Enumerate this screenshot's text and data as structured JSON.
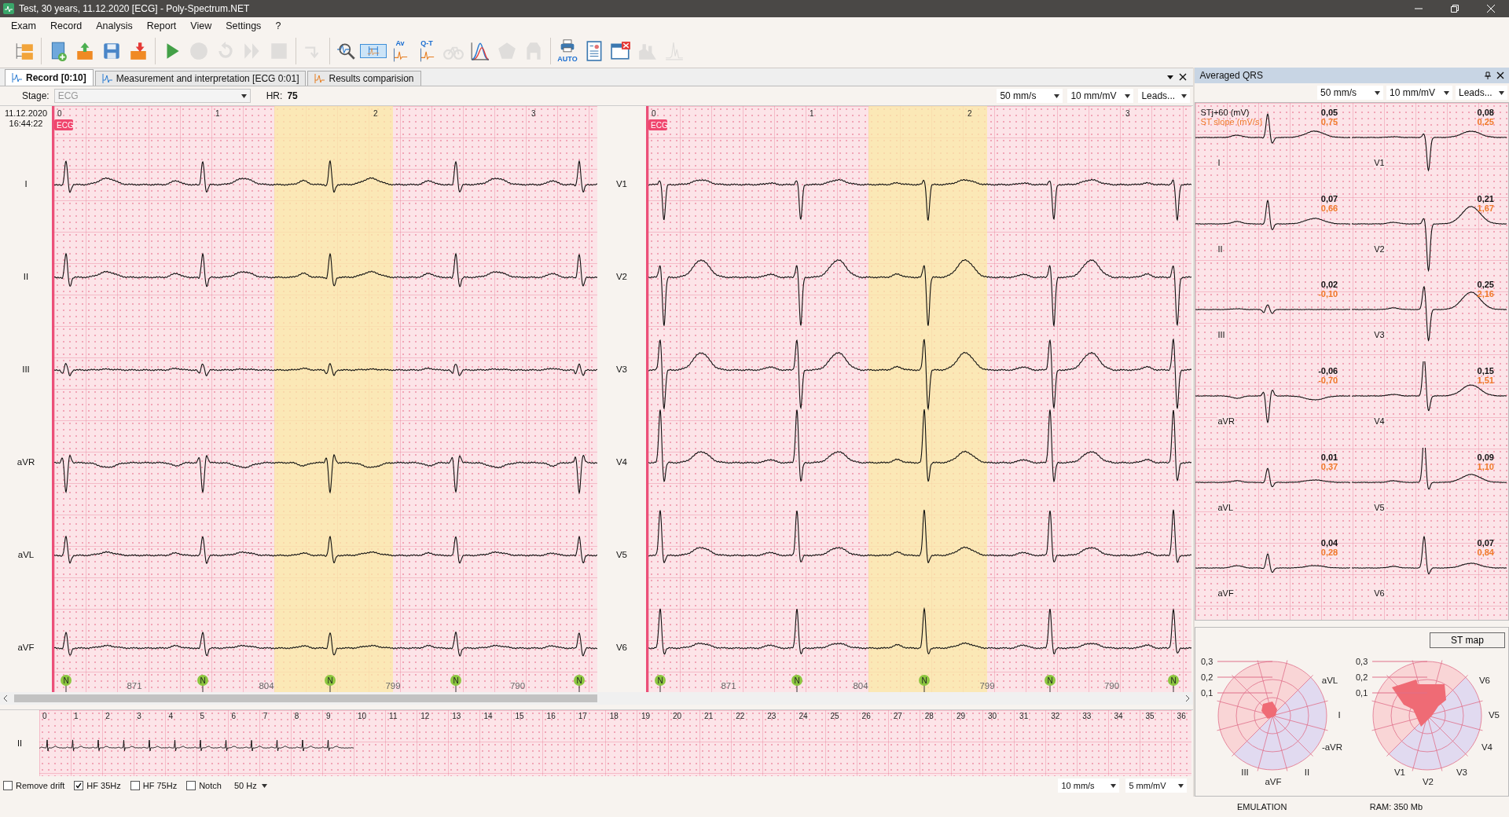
{
  "window": {
    "title": "Test, 30 years, 11.12.2020 [ECG] - Poly-Spectrum.NET"
  },
  "menu": [
    "Exam",
    "Record",
    "Analysis",
    "Report",
    "View",
    "Settings",
    "?"
  ],
  "toolbar": [
    [
      {
        "kind": "folders",
        "disabled": false,
        "selected": false
      }
    ],
    [
      {
        "kind": "new",
        "disabled": false,
        "selected": false
      },
      {
        "kind": "import",
        "disabled": false,
        "selected": false
      },
      {
        "kind": "save",
        "disabled": false,
        "selected": false
      },
      {
        "kind": "export",
        "disabled": false,
        "selected": false
      }
    ],
    [
      {
        "kind": "play",
        "disabled": false,
        "selected": false
      },
      {
        "kind": "stop",
        "disabled": true,
        "selected": false
      },
      {
        "kind": "rewind",
        "disabled": true,
        "selected": false
      },
      {
        "kind": "skip",
        "disabled": true,
        "selected": false
      },
      {
        "kind": "square",
        "disabled": true,
        "selected": false
      }
    ],
    [
      {
        "kind": "step",
        "disabled": true,
        "selected": false
      }
    ],
    [
      {
        "kind": "zoom",
        "disabled": false,
        "selected": false
      },
      {
        "kind": "measure",
        "disabled": false,
        "selected": true
      },
      {
        "kind": "labelwave",
        "label": "Av",
        "disabled": false,
        "selected": false
      },
      {
        "kind": "labelwave",
        "label": "Q-T",
        "disabled": false,
        "selected": false
      },
      {
        "kind": "bike",
        "disabled": true,
        "selected": false
      },
      {
        "kind": "hist",
        "disabled": false,
        "selected": false
      },
      {
        "kind": "pentagon",
        "disabled": true,
        "selected": false
      },
      {
        "kind": "figure",
        "disabled": true,
        "selected": false
      }
    ],
    [
      {
        "kind": "printer",
        "label": "AUTO",
        "disabled": false,
        "selected": false
      },
      {
        "kind": "report",
        "disabled": false,
        "selected": false
      },
      {
        "kind": "closewin",
        "disabled": false,
        "selected": false
      },
      {
        "kind": "bars",
        "disabled": true,
        "selected": false
      },
      {
        "kind": "spikes",
        "disabled": true,
        "selected": false
      }
    ]
  ],
  "tabs": [
    {
      "label": "Record [0:10]",
      "selected": true
    },
    {
      "label": "Measurement and interpretation [ECG 0:01]",
      "selected": false
    },
    {
      "label": "Results comparision",
      "selected": false
    }
  ],
  "stage": {
    "label": "Stage:",
    "value": "ECG",
    "disabled": true
  },
  "hr": {
    "label": "HR:",
    "value": "75"
  },
  "record_selectors": [
    "50 mm/s",
    "10 mm/mV",
    "Leads..."
  ],
  "record": {
    "date": "11.12.2020",
    "time": "16:44:22",
    "panels": [
      {
        "badge": "ECG",
        "ticks": [
          "0",
          "1",
          "2",
          "3"
        ],
        "leads": [
          "I",
          "II",
          "III",
          "aVR",
          "aVL",
          "aVF"
        ],
        "beats": [
          "N",
          "N",
          "N",
          "N",
          "N"
        ],
        "intervals": [
          "871",
          "804",
          "799",
          "790"
        ]
      },
      {
        "badge": "ECG",
        "ticks": [
          "0",
          "1",
          "2",
          "3"
        ],
        "leads": [
          "V1",
          "V2",
          "V3",
          "V4",
          "V5",
          "V6"
        ],
        "beats": [
          "N",
          "N",
          "N",
          "N",
          "N"
        ],
        "intervals": [
          "871",
          "804",
          "799",
          "790"
        ]
      }
    ]
  },
  "overview": {
    "lead": "II",
    "ticks": [
      "0",
      "1",
      "2",
      "3",
      "4",
      "5",
      "6",
      "7",
      "8",
      "9",
      "10",
      "11",
      "12",
      "13",
      "14",
      "15",
      "16",
      "17",
      "18",
      "19",
      "20",
      "21",
      "22",
      "23",
      "24",
      "25",
      "26",
      "27",
      "28",
      "29",
      "30",
      "31",
      "32",
      "33",
      "34",
      "35",
      "36"
    ]
  },
  "filters": [
    {
      "label": "Remove drift",
      "checked": false
    },
    {
      "label": "HF 35Hz",
      "checked": true
    },
    {
      "label": "HF 75Hz",
      "checked": false
    },
    {
      "label": "Notch",
      "checked": false
    }
  ],
  "notch_frequency": "50 Hz",
  "overview_selectors": [
    "10 mm/s",
    "5 mm/mV"
  ],
  "averaged_qrs": {
    "title": "Averaged QRS",
    "selectors": [
      "50 mm/s",
      "10 mm/mV",
      "Leads..."
    ],
    "legend": [
      "STj+60 (mV)",
      "ST slope (mV/s)"
    ],
    "leads": [
      {
        "name": "I",
        "st": "0,05",
        "slope": "0,75"
      },
      {
        "name": "V1",
        "st": "0,08",
        "slope": "0,25"
      },
      {
        "name": "II",
        "st": "0,07",
        "slope": "0,66"
      },
      {
        "name": "V2",
        "st": "0,21",
        "slope": "1,67"
      },
      {
        "name": "III",
        "st": "0,02",
        "slope": "-0,10"
      },
      {
        "name": "V3",
        "st": "0,25",
        "slope": "2,16"
      },
      {
        "name": "aVR",
        "st": "-0,06",
        "slope": "-0,70"
      },
      {
        "name": "V4",
        "st": "0,15",
        "slope": "1,51"
      },
      {
        "name": "aVL",
        "st": "0,01",
        "slope": "0,37"
      },
      {
        "name": "V5",
        "st": "0,09",
        "slope": "1,10"
      },
      {
        "name": "aVF",
        "st": "0,04",
        "slope": "0,28"
      },
      {
        "name": "V6",
        "st": "0,07",
        "slope": "0,84"
      }
    ]
  },
  "st_map": {
    "button": "ST map",
    "maps": [
      {
        "scale": [
          "0,3",
          "0,2",
          "0,1"
        ],
        "labels": [
          "aVL",
          "I",
          "-aVR",
          "II",
          "aVF",
          "III"
        ]
      },
      {
        "scale": [
          "0,3",
          "0,2",
          "0,1"
        ],
        "labels": [
          "V6",
          "V5",
          "V4",
          "V3",
          "V2",
          "V1"
        ]
      }
    ]
  },
  "status_bar": [
    "EMULATION",
    "RAM: 350 Mb"
  ]
}
